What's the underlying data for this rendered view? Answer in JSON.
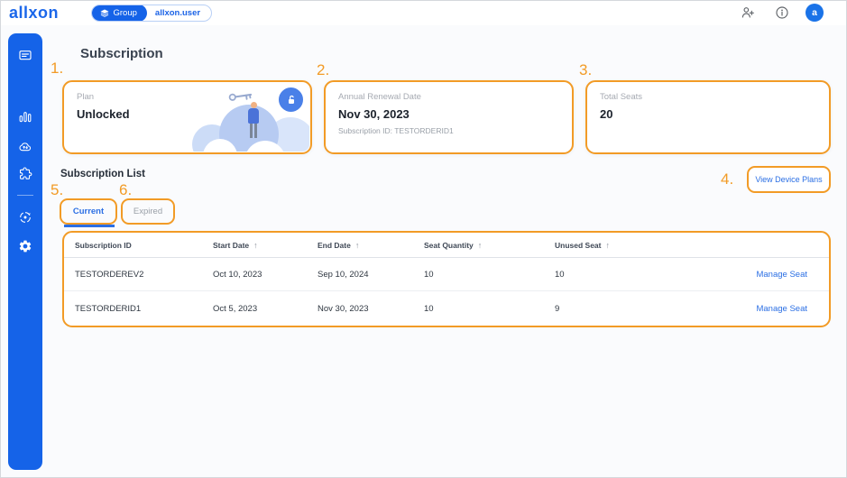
{
  "header": {
    "logo_text": "allxon",
    "group": {
      "label": "Group",
      "user": "allxon.user"
    },
    "avatar_initial": "a",
    "icons": [
      "layers-icon",
      "add-user-icon",
      "info-icon"
    ]
  },
  "sidebar": {
    "items": [
      {
        "icon": "devices-dashboard-icon"
      },
      {
        "icon": "analytics-icon"
      },
      {
        "icon": "ota-cloud-icon"
      },
      {
        "icon": "plugins-icon"
      },
      {
        "icon": "remote-access-icon"
      },
      {
        "icon": "settings-icon"
      }
    ]
  },
  "page": {
    "title": "Subscription",
    "annotations": [
      "1.",
      "2.",
      "3.",
      "4.",
      "5.",
      "6."
    ],
    "cards": [
      {
        "label": "Plan",
        "value": "Unlocked"
      },
      {
        "label": "Annual Renewal Date",
        "value": "Nov 30, 2023",
        "subtext": "Subscription ID: TESTORDERID1"
      },
      {
        "label": "Total Seats",
        "value": "20"
      }
    ],
    "list": {
      "title": "Subscription List",
      "view_device_plans": "View Device Plans",
      "tabs": [
        {
          "label": "Current",
          "active": true
        },
        {
          "label": "Expired",
          "active": false
        }
      ],
      "table": {
        "columns": [
          "Subscription ID",
          "Start Date",
          "End Date",
          "Seat Quantity",
          "Unused Seat"
        ],
        "sort_glyph": "↑",
        "rows": [
          {
            "subscription_id": "TESTORDEREV2",
            "start_date": "Oct 10, 2023",
            "end_date": "Sep 10, 2024",
            "seat_quantity": "10",
            "unused_seat": "10",
            "action": "Manage Seat"
          },
          {
            "subscription_id": "TESTORDERID1",
            "start_date": "Oct 5, 2023",
            "end_date": "Nov 30, 2023",
            "seat_quantity": "10",
            "unused_seat": "9",
            "action": "Manage Seat"
          }
        ]
      }
    }
  },
  "colors": {
    "primary_blue": "#1563e8",
    "link_blue": "#2b6fe4",
    "annotation_orange": "#f29b26"
  }
}
